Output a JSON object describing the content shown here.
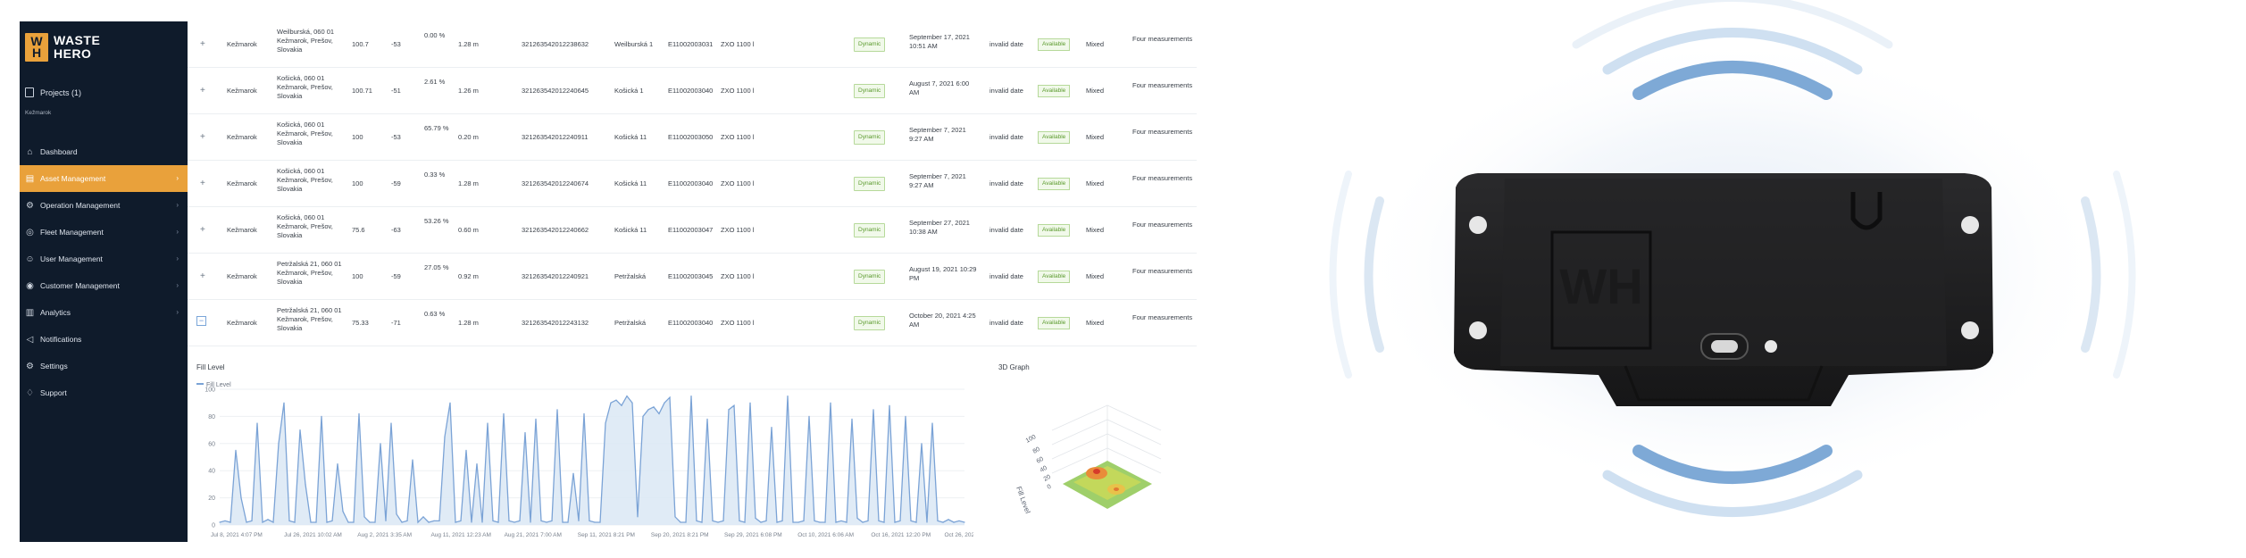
{
  "brand": {
    "line1": "WASTE",
    "line2": "HERO",
    "mark_top": "W",
    "mark_bottom": "H",
    "accent": "#e9a13b",
    "sidebar_bg": "#0f1b2b"
  },
  "sidebar": {
    "projects_label": "Projects (1)",
    "project_name": "Kežmarok",
    "items": [
      {
        "label": "Dashboard",
        "icon": "dashboard-icon",
        "chevron": false,
        "active": false
      },
      {
        "label": "Asset Management",
        "icon": "asset-icon",
        "chevron": true,
        "active": true
      },
      {
        "label": "Operation Management",
        "icon": "operation-icon",
        "chevron": true,
        "active": false
      },
      {
        "label": "Fleet Management",
        "icon": "fleet-icon",
        "chevron": true,
        "active": false
      },
      {
        "label": "User Management",
        "icon": "user-icon",
        "chevron": true,
        "active": false
      },
      {
        "label": "Customer Management",
        "icon": "customer-icon",
        "chevron": true,
        "active": false
      },
      {
        "label": "Analytics",
        "icon": "analytics-icon",
        "chevron": true,
        "active": false
      },
      {
        "label": "Notifications",
        "icon": "notifications-icon",
        "chevron": false,
        "active": false
      },
      {
        "label": "Settings",
        "icon": "settings-icon",
        "chevron": false,
        "active": false
      },
      {
        "label": "Support",
        "icon": "support-icon",
        "chevron": false,
        "active": false
      }
    ]
  },
  "table": {
    "rows": [
      {
        "expand": "+",
        "city": "Kežmarok",
        "address": "Weilburská, 060 01 Kežmarok, Prešov, Slovakia",
        "n1": "100.7",
        "n2": "-53",
        "fill": "0.00 %",
        "distance": "1.28 m",
        "device_id": "321263542012238632",
        "street": "Weilburská 1",
        "code": "E11002003031",
        "container": "ZXO 1100 l",
        "mode": "Dynamic",
        "last_date": "September 17, 2021 10:51 AM",
        "date_status": "invalid date",
        "availability": "Available",
        "waste": "Mixed",
        "measurements": "Four measurements"
      },
      {
        "expand": "+",
        "city": "Kežmarok",
        "address": "Košická, 060 01 Kežmarok, Prešov, Slovakia",
        "n1": "100.71",
        "n2": "-51",
        "fill": "2.61 %",
        "distance": "1.26 m",
        "device_id": "321263542012240645",
        "street": "Košická 1",
        "code": "E11002003040",
        "container": "ZXO 1100 l",
        "mode": "Dynamic",
        "last_date": "August 7, 2021 6:00 AM",
        "date_status": "invalid date",
        "availability": "Available",
        "waste": "Mixed",
        "measurements": "Four measurements"
      },
      {
        "expand": "+",
        "city": "Kežmarok",
        "address": "Košická, 060 01 Kežmarok, Prešov, Slovakia",
        "n1": "100",
        "n2": "-53",
        "fill": "65.79 %",
        "distance": "0.20 m",
        "device_id": "321263542012240911",
        "street": "Košická 11",
        "code": "E11002003050",
        "container": "ZXO 1100 l",
        "mode": "Dynamic",
        "last_date": "September 7, 2021 9:27 AM",
        "date_status": "invalid date",
        "availability": "Available",
        "waste": "Mixed",
        "measurements": "Four measurements"
      },
      {
        "expand": "+",
        "city": "Kežmarok",
        "address": "Košická, 060 01 Kežmarok, Prešov, Slovakia",
        "n1": "100",
        "n2": "-59",
        "fill": "0.33 %",
        "distance": "1.28 m",
        "device_id": "321263542012240674",
        "street": "Košická 11",
        "code": "E11002003040",
        "container": "ZXO 1100 l",
        "mode": "Dynamic",
        "last_date": "September 7, 2021 9:27 AM",
        "date_status": "invalid date",
        "availability": "Available",
        "waste": "Mixed",
        "measurements": "Four measurements"
      },
      {
        "expand": "+",
        "city": "Kežmarok",
        "address": "Košická, 060 01 Kežmarok, Prešov, Slovakia",
        "n1": "75.6",
        "n2": "-63",
        "fill": "53.26 %",
        "distance": "0.60 m",
        "device_id": "321263542012240662",
        "street": "Košická 11",
        "code": "E11002003047",
        "container": "ZXO 1100 l",
        "mode": "Dynamic",
        "last_date": "September 27, 2021 10:38 AM",
        "date_status": "invalid date",
        "availability": "Available",
        "waste": "Mixed",
        "measurements": "Four measurements"
      },
      {
        "expand": "+",
        "city": "Kežmarok",
        "address": "Petržalská 21, 060 01 Kežmarok, Prešov, Slovakia",
        "n1": "100",
        "n2": "-59",
        "fill": "27.05 %",
        "distance": "0.92 m",
        "device_id": "321263542012240921",
        "street": "Petržalská",
        "code": "E11002003045",
        "container": "ZXO 1100 l",
        "mode": "Dynamic",
        "last_date": "August 19, 2021 10:29 PM",
        "date_status": "invalid date",
        "availability": "Available",
        "waste": "Mixed",
        "measurements": "Four measurements"
      },
      {
        "expand": "−",
        "city": "Kežmarok",
        "address": "Petržalská 21, 060 01 Kežmarok, Prešov, Slovakia",
        "n1": "75.33",
        "n2": "-71",
        "fill": "0.63 %",
        "distance": "1.28 m",
        "device_id": "321263542012243132",
        "street": "Petržalská",
        "code": "E11002003040",
        "container": "ZXO 1100 l",
        "mode": "Dynamic",
        "last_date": "October 20, 2021 4:25 AM",
        "date_status": "invalid date",
        "availability": "Available",
        "waste": "Mixed",
        "measurements": "Four measurements"
      }
    ]
  },
  "fill_panel": {
    "title": "Fill Level"
  },
  "graph3d_panel": {
    "title": "3D Graph",
    "axis_label": "Fill Level",
    "ticks": [
      "100",
      "80",
      "60",
      "40",
      "20",
      "0"
    ]
  },
  "chart_data": {
    "type": "area",
    "legend": "Fill Level",
    "ylim": [
      0,
      100
    ],
    "yticks": [
      0,
      20,
      40,
      60,
      80,
      100
    ],
    "color": "#7ba3d6",
    "x_labels": [
      "Jul 8, 2021 4:07 PM",
      "Jul 26, 2021 10:02 AM",
      "Aug 2, 2021 3:35 AM",
      "Aug 11, 2021 12:23 AM",
      "Aug 21, 2021 7:00 AM",
      "Sep 11, 2021 8:21 PM",
      "Sep 20, 2021 8:21 PM",
      "Sep 29, 2021 6:08 PM",
      "Oct 10, 2021 6:06 AM",
      "Oct 16, 2021 12:20 PM",
      "Oct 26, 2021 7:"
    ],
    "values": [
      2,
      3,
      2,
      55,
      20,
      2,
      3,
      75,
      2,
      4,
      2,
      60,
      90,
      3,
      2,
      70,
      30,
      2,
      2,
      80,
      2,
      3,
      45,
      10,
      2,
      2,
      82,
      6,
      2,
      2,
      60,
      3,
      75,
      8,
      2,
      3,
      48,
      2,
      6,
      2,
      3,
      3,
      65,
      90,
      2,
      3,
      55,
      2,
      45,
      2,
      75,
      3,
      2,
      82,
      3,
      2,
      3,
      68,
      2,
      78,
      3,
      2,
      3,
      85,
      2,
      2,
      38,
      3,
      82,
      3,
      2,
      2,
      75,
      90,
      92,
      88,
      95,
      90,
      6,
      80,
      85,
      87,
      82,
      90,
      94,
      6,
      2,
      2,
      95,
      3,
      2,
      78,
      3,
      2,
      3,
      85,
      88,
      3,
      2,
      90,
      5,
      2,
      3,
      72,
      2,
      3,
      95,
      2,
      2,
      3,
      80,
      3,
      2,
      2,
      90,
      2,
      3,
      2,
      78,
      5,
      2,
      3,
      85,
      3,
      2,
      88,
      2,
      3,
      80,
      3,
      2,
      60,
      2,
      75,
      3,
      2,
      4,
      2,
      3,
      2
    ]
  },
  "device": {
    "logo_letters": "WH"
  }
}
